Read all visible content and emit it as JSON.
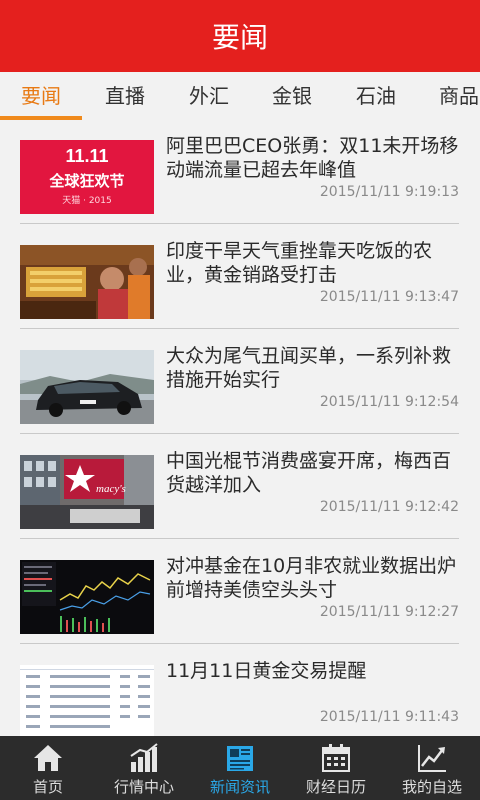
{
  "header": {
    "title": "要闻"
  },
  "tabs": [
    {
      "label": "要闻"
    },
    {
      "label": "直播"
    },
    {
      "label": "外汇"
    },
    {
      "label": "金银"
    },
    {
      "label": "石油"
    },
    {
      "label": "商品"
    }
  ],
  "news": [
    {
      "title": "阿里巴巴CEO张勇：双11未开场移动端流量已超去年峰值",
      "time": "2015/11/11 9:19:13",
      "thumb": {
        "line1": "11.11",
        "line2": "全球狂欢节",
        "line3": "天猫 · 2015"
      }
    },
    {
      "title": "印度干旱天气重挫靠天吃饭的农业，黄金销路受打击",
      "time": "2015/11/11 9:13:47"
    },
    {
      "title": "大众为尾气丑闻买单，一系列补救措施开始实行",
      "time": "2015/11/11 9:12:54"
    },
    {
      "title": "中国光棍节消费盛宴开席，梅西百货越洋加入",
      "time": "2015/11/11 9:12:42",
      "thumb": {
        "sign": "macy's"
      }
    },
    {
      "title": "对冲基金在10月非农就业数据出炉前增持美债空头头寸",
      "time": "2015/11/11 9:12:27"
    },
    {
      "title": "11月11日黄金交易提醒",
      "time": "2015/11/11 9:11:43"
    }
  ],
  "bottom_nav": [
    {
      "label": "首页",
      "icon": "home-icon"
    },
    {
      "label": "行情中心",
      "icon": "bar-chart-icon"
    },
    {
      "label": "新闻资讯",
      "icon": "newspaper-icon"
    },
    {
      "label": "财经日历",
      "icon": "calendar-icon"
    },
    {
      "label": "我的自选",
      "icon": "trend-chart-icon"
    }
  ],
  "colors": {
    "brand_red": "#e4201e",
    "tab_active": "#e87a14",
    "nav_active": "#2aa8e8",
    "nav_bg": "#2c2c2c"
  }
}
